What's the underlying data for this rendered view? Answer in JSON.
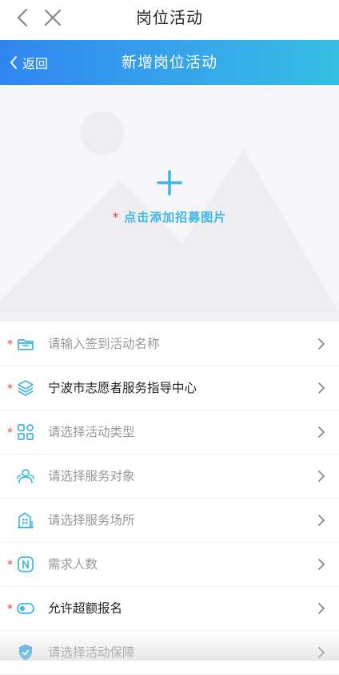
{
  "topbar": {
    "title": "岗位活动"
  },
  "header": {
    "back_label": "返回",
    "title": "新增岗位活动"
  },
  "upload": {
    "required": "*",
    "label": "点击添加招募图片"
  },
  "form": {
    "rows": [
      {
        "required": "*",
        "text": "请输入签到活动名称"
      },
      {
        "required": "*",
        "text": "宁波市志愿者服务指导中心"
      },
      {
        "required": "*",
        "text": "请选择活动类型"
      },
      {
        "required": "",
        "text": "请选择服务对象"
      },
      {
        "required": "",
        "text": "请选择服务场所"
      },
      {
        "required": "*",
        "text": "需求人数"
      },
      {
        "required": "*",
        "text": "允许超额报名"
      },
      {
        "required": "",
        "text": "请选择活动保障"
      }
    ]
  },
  "colors": {
    "accent": "#36a8ec",
    "required": "#e8453c",
    "icon": "#3fb6e6"
  }
}
